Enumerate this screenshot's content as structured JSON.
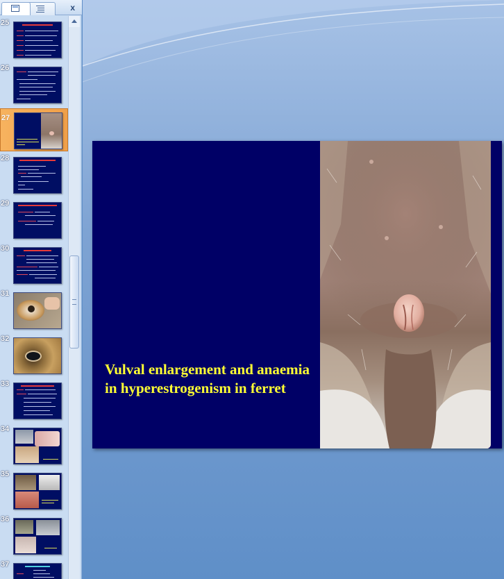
{
  "pane": {
    "close_label": "x",
    "slides": [
      {
        "number": "25",
        "kind": "text"
      },
      {
        "number": "26",
        "kind": "text"
      },
      {
        "number": "27",
        "kind": "photo-text",
        "selected": true
      },
      {
        "number": "28",
        "kind": "text"
      },
      {
        "number": "29",
        "kind": "text"
      },
      {
        "number": "30",
        "kind": "text"
      },
      {
        "number": "31",
        "kind": "photo"
      },
      {
        "number": "32",
        "kind": "photo"
      },
      {
        "number": "33",
        "kind": "text"
      },
      {
        "number": "34",
        "kind": "photos"
      },
      {
        "number": "35",
        "kind": "photos"
      },
      {
        "number": "36",
        "kind": "photos"
      },
      {
        "number": "37",
        "kind": "text"
      }
    ]
  },
  "slide": {
    "title": "Vulval enlargement and anaemia in hyperestrogenism in ferret",
    "background_color": "#000066",
    "title_color": "#ffff33",
    "image": "ferret-vulva-photo"
  },
  "colors": {
    "workspace_top": "#a7c2e6",
    "workspace_bottom": "#5f8fc8",
    "selected_thumb": "#f7b35f"
  }
}
